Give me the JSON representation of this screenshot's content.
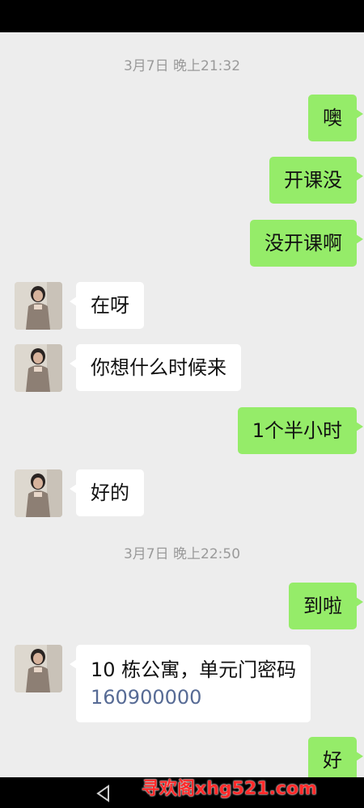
{
  "messages": {
    "ts1": "3月7日 晚上21:32",
    "m1": "噢",
    "m2": "开课没",
    "m3": "没开课啊",
    "m4": "在呀",
    "m5": "你想什么时候来",
    "m6": "1个半小时",
    "m7": "好的",
    "ts2": "3月7日 晚上22:50",
    "m8": "到啦",
    "m9_line1": "10 栋公寓，单元门密码",
    "m9_code": "160900000",
    "m10": "好"
  },
  "watermark": "寻欢阁xhg521.com",
  "colors": {
    "outgoing_bubble": "#95ec69",
    "incoming_bubble": "#ffffff",
    "background": "#ededed",
    "link": "#576b95",
    "watermark": "#ff2a2a"
  },
  "icons": {
    "back": "back-triangle-icon"
  }
}
